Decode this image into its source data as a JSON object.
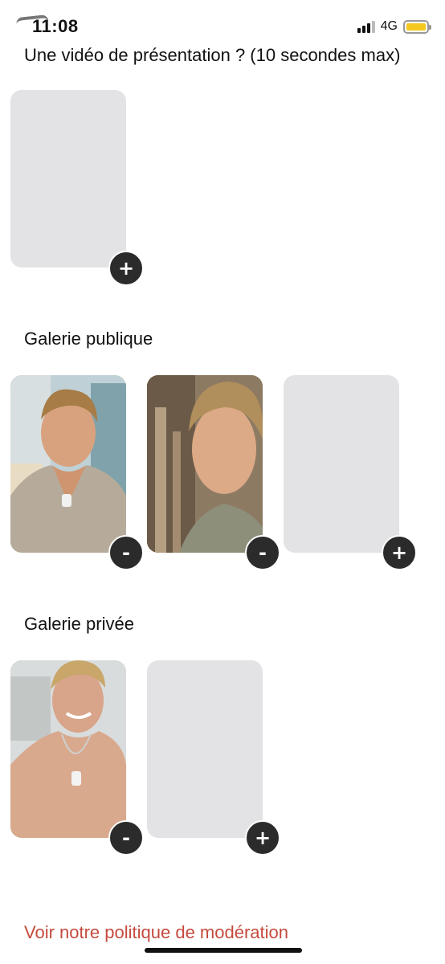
{
  "status_bar": {
    "time": "11:08",
    "network": "4G",
    "battery_color": "#f5c81f"
  },
  "video_section": {
    "title": "Une vidéo de présentation ? (10 secondes max)",
    "add_symbol": "+"
  },
  "public_gallery": {
    "title": "Galerie publique",
    "items": [
      {
        "type": "photo",
        "action": "-"
      },
      {
        "type": "photo",
        "action": "-"
      },
      {
        "type": "empty",
        "action": "+"
      }
    ]
  },
  "private_gallery": {
    "title": "Galerie privée",
    "items": [
      {
        "type": "photo",
        "action": "-"
      },
      {
        "type": "empty",
        "action": "+"
      }
    ]
  },
  "footer": {
    "moderation_link": "Voir notre politique de modération"
  },
  "colors": {
    "slot_bg": "#e3e2e5",
    "button_bg": "#2b2b2b",
    "link": "#c64a3e"
  }
}
